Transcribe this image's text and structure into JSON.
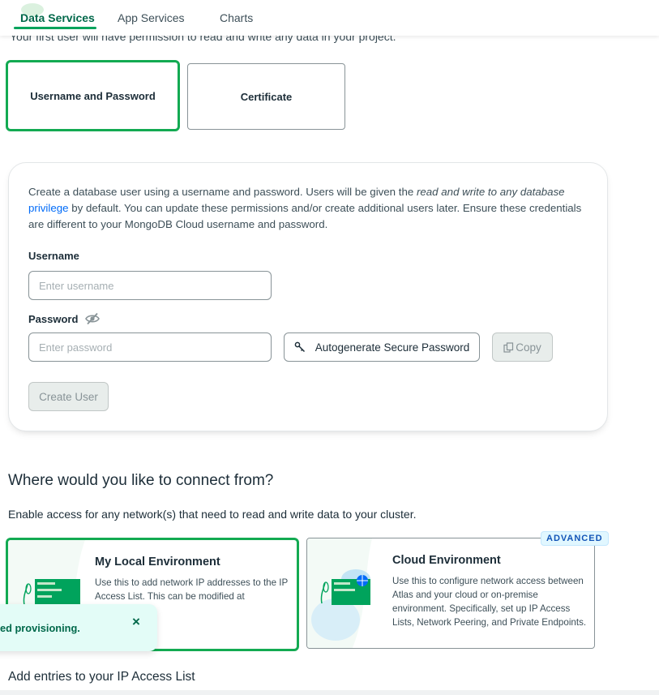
{
  "tabs": [
    {
      "label": "Data Services",
      "active": true
    },
    {
      "label": "App Services",
      "active": false
    },
    {
      "label": "Charts",
      "active": false
    }
  ],
  "clipped_text": "Your first user will have permission to read and write any data in your project.",
  "auth_methods": [
    {
      "label": "Username and Password",
      "selected": true
    },
    {
      "label": "Certificate",
      "selected": false
    }
  ],
  "create_user": {
    "intro_part1": "Create a database user using a username and password. Users will be given the ",
    "intro_em": "read and write to any database",
    "intro_link": "privilege",
    "intro_part2": " by default. You can update these permissions and/or create additional users later. Ensure these credentials are different to your MongoDB Cloud username and password.",
    "username_label": "Username",
    "username_placeholder": "Enter username",
    "username_value": "",
    "password_label": "Password",
    "password_placeholder": "Enter password",
    "password_value": "",
    "autogenerate_label": "Autogenerate Secure Password",
    "copy_label": "Copy",
    "create_label": "Create User"
  },
  "connect": {
    "heading": "Where would you like to connect from?",
    "subheading": "Enable access for any network(s) that need to read and write data to your cluster.",
    "environments": [
      {
        "title": "My Local Environment",
        "description": "Use this to add network IP addresses to the IP Access List. This can be modified at",
        "selected": true
      },
      {
        "title": "Cloud Environment",
        "description": "Use this to configure network access between Atlas and your cloud or on-premise environment. Specifically, set up IP Access Lists, Network Peering, and Private Endpoints.",
        "selected": false,
        "badge": "ADVANCED"
      }
    ]
  },
  "toast": {
    "text": "ed provisioning.",
    "close": "×"
  },
  "ip_access_heading": "Add entries to your IP Access List",
  "colors": {
    "brand_green": "#13aa52",
    "active_tab": "#00684a",
    "link": "#016bf8"
  }
}
